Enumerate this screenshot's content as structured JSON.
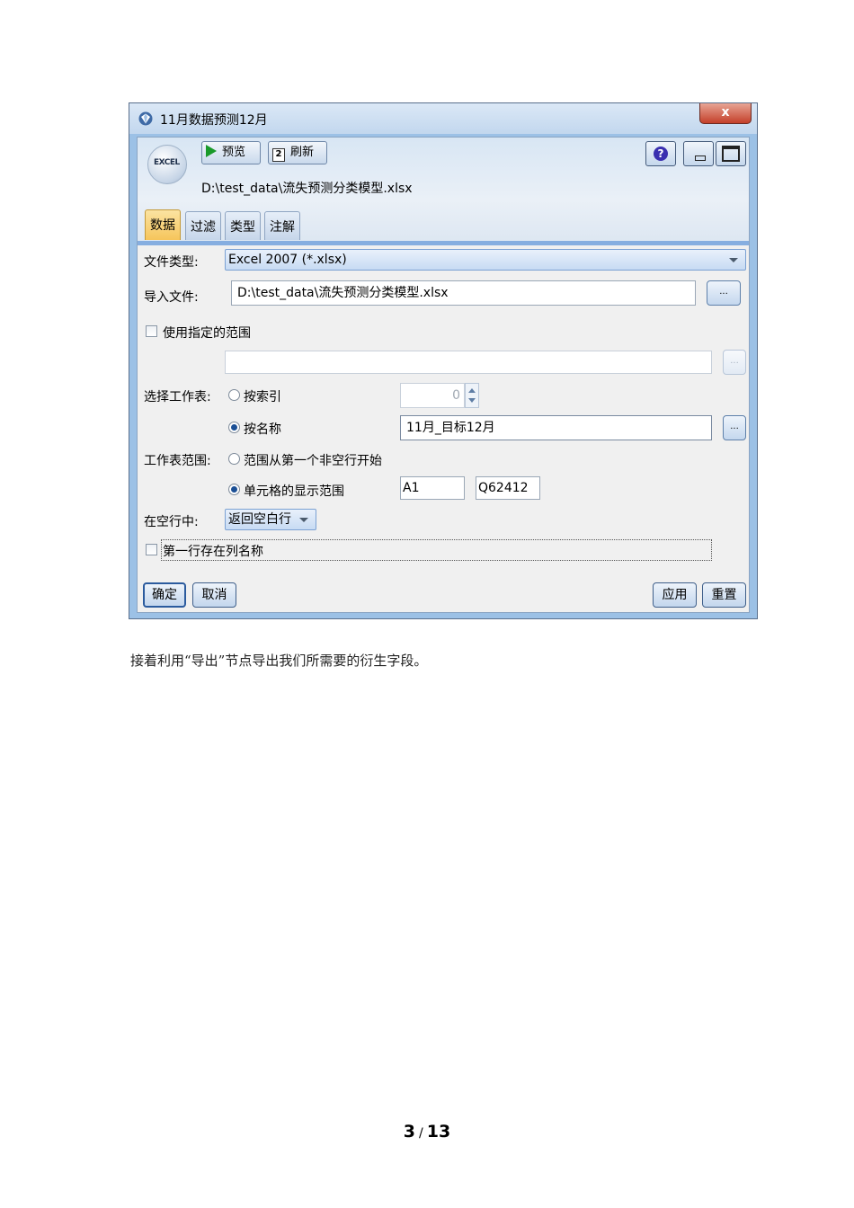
{
  "window": {
    "title": "11月数据预测12月",
    "close_glyph": "x"
  },
  "toolbar": {
    "excel_icon_text": "EXCEL",
    "preview_label": "预览",
    "refresh_icon_text": "2",
    "refresh_label": "刷新",
    "help_glyph": "?"
  },
  "header": {
    "file_path": "D:\\test_data\\流失预测分类模型.xlsx"
  },
  "tabs": [
    {
      "label": "数据",
      "active": true
    },
    {
      "label": "过滤",
      "active": false
    },
    {
      "label": "类型",
      "active": false
    },
    {
      "label": "注解",
      "active": false
    }
  ],
  "form": {
    "file_type_label": "文件类型:",
    "file_type_value": "Excel 2007 (*.xlsx)",
    "import_file_label": "导入文件:",
    "import_file_value": "D:\\test_data\\流失预测分类模型.xlsx",
    "browse_label": "...",
    "use_range_label": "使用指定的范围",
    "range_value": "",
    "select_sheet_label": "选择工作表:",
    "by_index_label": "按索引",
    "index_value": "0",
    "by_name_label": "按名称",
    "sheet_name_value": "11月_目标12月",
    "sheet_range_label": "工作表范围:",
    "range_first_row_label": "范围从第一个非空行开始",
    "cell_range_label": "单元格的显示范围",
    "cell_from": "A1",
    "cell_to": "Q62412",
    "empty_rows_label": "在空行中:",
    "empty_rows_value": "返回空白行",
    "first_row_names_label": "第一行存在列名称"
  },
  "buttons": {
    "ok": "确定",
    "cancel": "取消",
    "apply": "应用",
    "reset": "重置"
  },
  "document": {
    "caption": "接着利用“导出”节点导出我们所需要的衍生字段。",
    "page_current": "3",
    "page_sep": "/",
    "page_total": "13"
  }
}
